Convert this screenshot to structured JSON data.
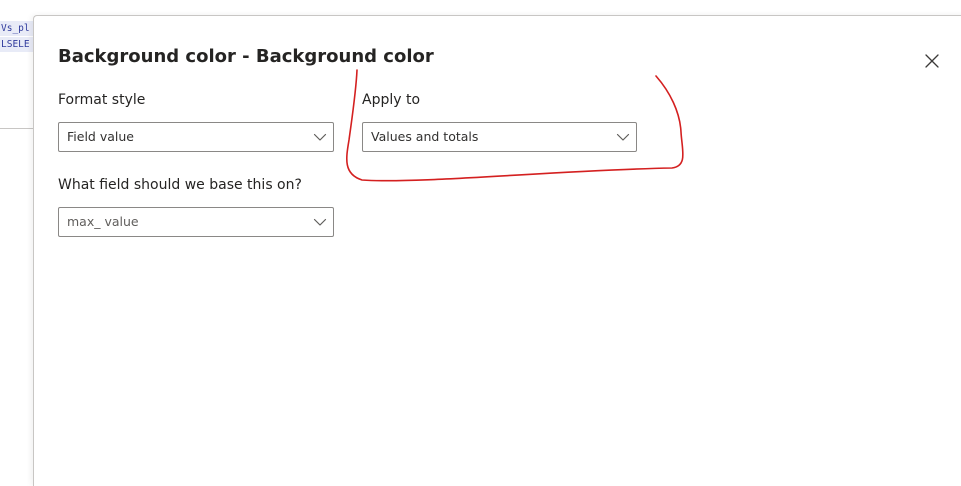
{
  "background": {
    "code_lines": [
      "Vs_pl",
      "LSELE"
    ]
  },
  "dialog": {
    "title": "Background color - Background color",
    "format_style": {
      "label": "Format style",
      "value": "Field value"
    },
    "apply_to": {
      "label": "Apply to",
      "value": "Values and totals"
    },
    "base_field": {
      "label": "What field should we base this on?",
      "value": "max_ value"
    }
  },
  "icons": {
    "close": "close-icon",
    "dropdown": "chevron-down-icon"
  },
  "colors": {
    "annotation": "#d42020",
    "border": "#8a8886",
    "text": "#252423"
  }
}
